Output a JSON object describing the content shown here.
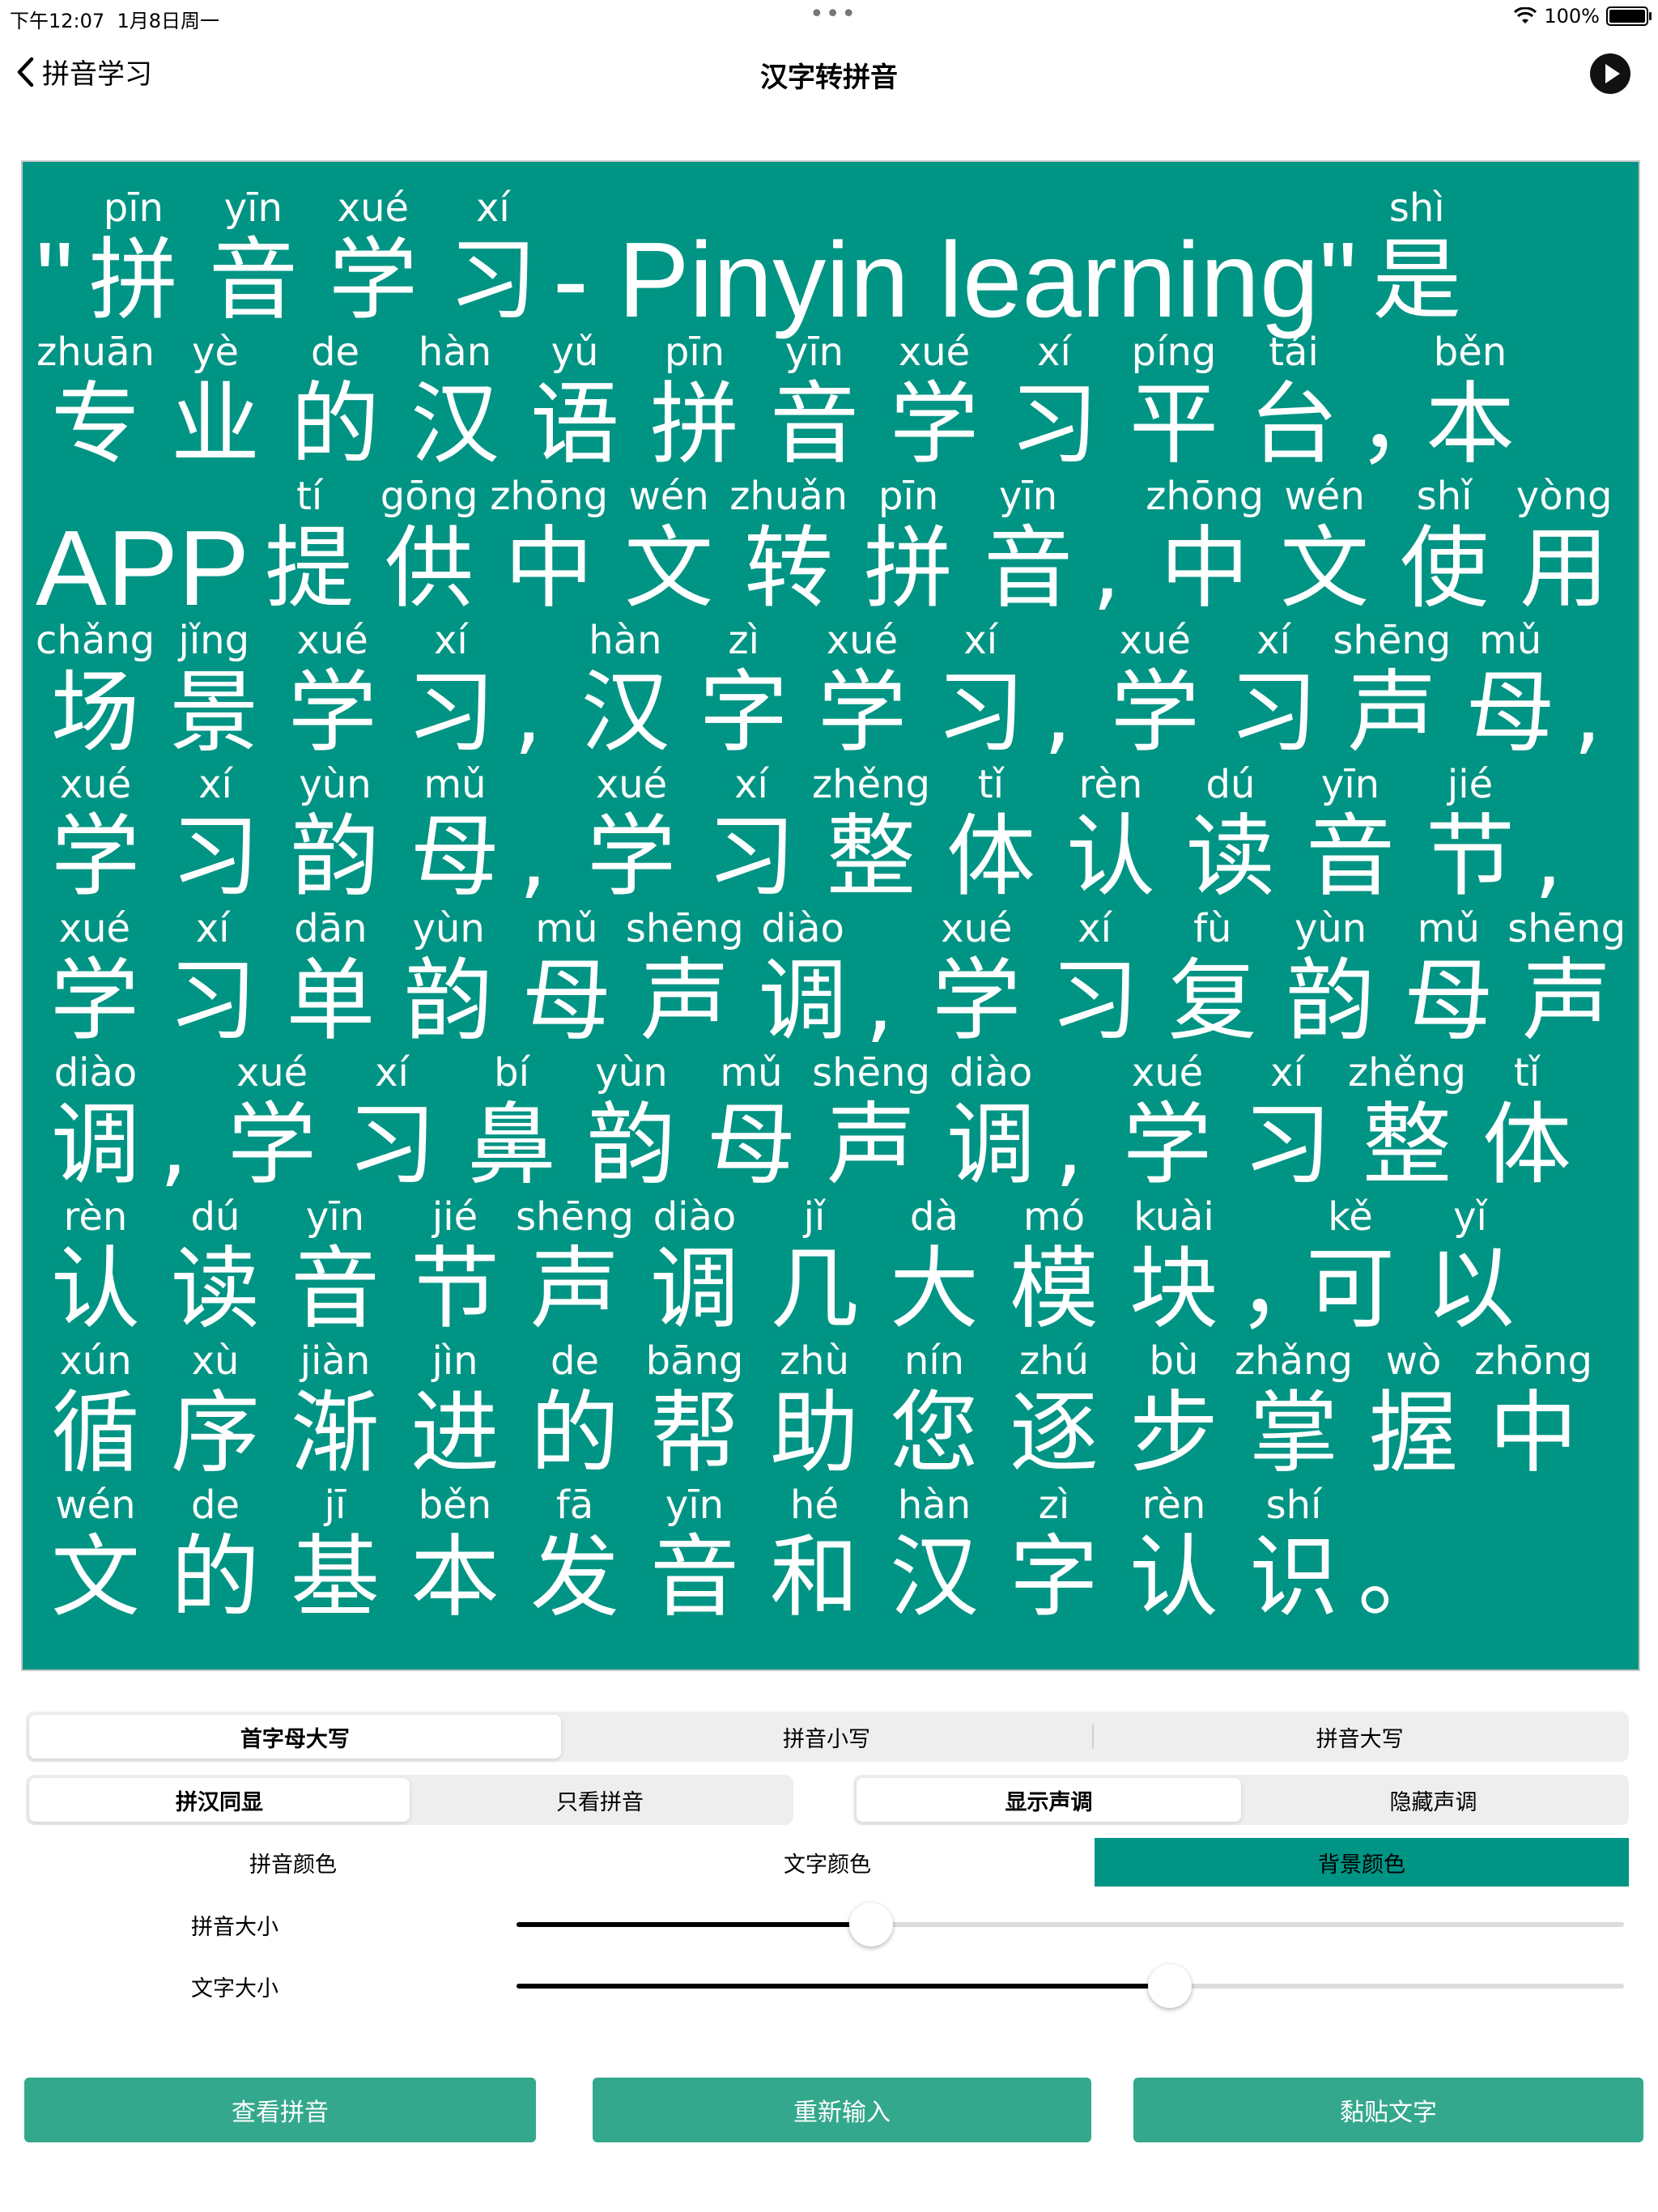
{
  "status": {
    "time": "下午12:07",
    "date": "1月8日周一",
    "dots": "•••",
    "battery_text": "100%",
    "battery_level": 1.0
  },
  "nav": {
    "back_label": "拼音学习",
    "title": "汉字转拼音"
  },
  "board": {
    "bg_color": "#009484",
    "lines": [
      [
        {
          "t": "seg",
          "hz": "\""
        },
        {
          "hz": "拼",
          "py": "pīn"
        },
        {
          "hz": "音",
          "py": "yīn"
        },
        {
          "hz": "学",
          "py": "xué"
        },
        {
          "hz": "习",
          "py": "xí"
        },
        {
          "t": "seg",
          "hz": "- Pinyin learning\""
        },
        {
          "hz": "是",
          "py": "shì"
        }
      ],
      [
        {
          "hz": "专",
          "py": "zhuān"
        },
        {
          "hz": "业",
          "py": "yè"
        },
        {
          "hz": "的",
          "py": "de"
        },
        {
          "hz": "汉",
          "py": "hàn"
        },
        {
          "hz": "语",
          "py": "yǔ"
        },
        {
          "hz": "拼",
          "py": "pīn"
        },
        {
          "hz": "音",
          "py": "yīn"
        },
        {
          "hz": "学",
          "py": "xué"
        },
        {
          "hz": "习",
          "py": "xí"
        },
        {
          "hz": "平",
          "py": "píng"
        },
        {
          "hz": "台",
          "py": "tái"
        },
        {
          "t": "p",
          "hz": "，"
        },
        {
          "hz": "本",
          "py": "běn"
        }
      ],
      [
        {
          "t": "seg",
          "hz": "APP"
        },
        {
          "hz": "提",
          "py": "tí"
        },
        {
          "hz": "供",
          "py": "gōng"
        },
        {
          "hz": "中",
          "py": "zhōng"
        },
        {
          "hz": "文",
          "py": "wén"
        },
        {
          "hz": "转",
          "py": "zhuǎn"
        },
        {
          "hz": "拼",
          "py": "pīn"
        },
        {
          "hz": "音",
          "py": "yīn"
        },
        {
          "t": "p",
          "hz": ","
        },
        {
          "hz": "中",
          "py": "zhōng"
        },
        {
          "hz": "文",
          "py": "wén"
        },
        {
          "hz": "使",
          "py": "shǐ"
        },
        {
          "hz": "用",
          "py": "yòng"
        }
      ],
      [
        {
          "hz": "场",
          "py": "chǎng"
        },
        {
          "hz": "景",
          "py": "jǐng"
        },
        {
          "hz": "学",
          "py": "xué"
        },
        {
          "hz": "习",
          "py": "xí"
        },
        {
          "t": "p",
          "hz": ","
        },
        {
          "hz": "汉",
          "py": "hàn"
        },
        {
          "hz": "字",
          "py": "zì"
        },
        {
          "hz": "学",
          "py": "xué"
        },
        {
          "hz": "习",
          "py": "xí"
        },
        {
          "t": "p",
          "hz": ","
        },
        {
          "hz": "学",
          "py": "xué"
        },
        {
          "hz": "习",
          "py": "xí"
        },
        {
          "hz": "声",
          "py": "shēng"
        },
        {
          "hz": "母",
          "py": "mǔ"
        },
        {
          "t": "p",
          "hz": ","
        }
      ],
      [
        {
          "hz": "学",
          "py": "xué"
        },
        {
          "hz": "习",
          "py": "xí"
        },
        {
          "hz": "韵",
          "py": "yùn"
        },
        {
          "hz": "母",
          "py": "mǔ"
        },
        {
          "t": "p",
          "hz": ","
        },
        {
          "hz": "学",
          "py": "xué"
        },
        {
          "hz": "习",
          "py": "xí"
        },
        {
          "hz": "整",
          "py": "zhěng"
        },
        {
          "hz": "体",
          "py": "tǐ"
        },
        {
          "hz": "认",
          "py": "rèn"
        },
        {
          "hz": "读",
          "py": "dú"
        },
        {
          "hz": "音",
          "py": "yīn"
        },
        {
          "hz": "节",
          "py": "jié"
        },
        {
          "t": "p",
          "hz": ","
        }
      ],
      [
        {
          "hz": "学",
          "py": "xué"
        },
        {
          "hz": "习",
          "py": "xí"
        },
        {
          "hz": "单",
          "py": "dān"
        },
        {
          "hz": "韵",
          "py": "yùn"
        },
        {
          "hz": "母",
          "py": "mǔ"
        },
        {
          "hz": "声",
          "py": "shēng"
        },
        {
          "hz": "调",
          "py": "diào"
        },
        {
          "t": "p",
          "hz": ","
        },
        {
          "hz": "学",
          "py": "xué"
        },
        {
          "hz": "习",
          "py": "xí"
        },
        {
          "hz": "复",
          "py": "fù"
        },
        {
          "hz": "韵",
          "py": "yùn"
        },
        {
          "hz": "母",
          "py": "mǔ"
        },
        {
          "hz": "声",
          "py": "shēng"
        }
      ],
      [
        {
          "hz": "调",
          "py": "diào"
        },
        {
          "t": "p",
          "hz": ","
        },
        {
          "hz": "学",
          "py": "xué"
        },
        {
          "hz": "习",
          "py": "xí"
        },
        {
          "hz": "鼻",
          "py": "bí"
        },
        {
          "hz": "韵",
          "py": "yùn"
        },
        {
          "hz": "母",
          "py": "mǔ"
        },
        {
          "hz": "声",
          "py": "shēng"
        },
        {
          "hz": "调",
          "py": "diào"
        },
        {
          "t": "p",
          "hz": ","
        },
        {
          "hz": "学",
          "py": "xué"
        },
        {
          "hz": "习",
          "py": "xí"
        },
        {
          "hz": "整",
          "py": "zhěng"
        },
        {
          "hz": "体",
          "py": "tǐ"
        }
      ],
      [
        {
          "hz": "认",
          "py": "rèn"
        },
        {
          "hz": "读",
          "py": "dú"
        },
        {
          "hz": "音",
          "py": "yīn"
        },
        {
          "hz": "节",
          "py": "jié"
        },
        {
          "hz": "声",
          "py": "shēng"
        },
        {
          "hz": "调",
          "py": "diào"
        },
        {
          "hz": "几",
          "py": "jǐ"
        },
        {
          "hz": "大",
          "py": "dà"
        },
        {
          "hz": "模",
          "py": "mó"
        },
        {
          "hz": "块",
          "py": "kuài"
        },
        {
          "t": "p",
          "hz": "，"
        },
        {
          "hz": "可",
          "py": "kě"
        },
        {
          "hz": "以",
          "py": "yǐ"
        }
      ],
      [
        {
          "hz": "循",
          "py": "xún"
        },
        {
          "hz": "序",
          "py": "xù"
        },
        {
          "hz": "渐",
          "py": "jiàn"
        },
        {
          "hz": "进",
          "py": "jìn"
        },
        {
          "hz": "的",
          "py": "de"
        },
        {
          "hz": "帮",
          "py": "bāng"
        },
        {
          "hz": "助",
          "py": "zhù"
        },
        {
          "hz": "您",
          "py": "nín"
        },
        {
          "hz": "逐",
          "py": "zhú"
        },
        {
          "hz": "步",
          "py": "bù"
        },
        {
          "hz": "掌",
          "py": "zhǎng"
        },
        {
          "hz": "握",
          "py": "wò"
        },
        {
          "hz": "中",
          "py": "zhōng"
        }
      ],
      [
        {
          "hz": "文",
          "py": "wén"
        },
        {
          "hz": "的",
          "py": "de"
        },
        {
          "hz": "基",
          "py": "jī"
        },
        {
          "hz": "本",
          "py": "běn"
        },
        {
          "hz": "发",
          "py": "fā"
        },
        {
          "hz": "音",
          "py": "yīn"
        },
        {
          "hz": "和",
          "py": "hé"
        },
        {
          "hz": "汉",
          "py": "hàn"
        },
        {
          "hz": "字",
          "py": "zì"
        },
        {
          "hz": "认",
          "py": "rèn"
        },
        {
          "hz": "识",
          "py": "shí"
        },
        {
          "t": "p",
          "hz": "。"
        }
      ]
    ]
  },
  "case_options": {
    "items": [
      "首字母大写",
      "拼音小写",
      "拼音大写"
    ],
    "selected": 0
  },
  "display_mode": {
    "items": [
      "拼汉同显",
      "只看拼音"
    ],
    "selected": 0
  },
  "tone_mode": {
    "items": [
      "显示声调",
      "隐藏声调"
    ],
    "selected": 0
  },
  "color_options": {
    "items": [
      "拼音颜色",
      "文字颜色",
      "背景颜色"
    ],
    "selected": 2
  },
  "sliders": {
    "pinyin_size": {
      "label": "拼音大小",
      "value": 0.32
    },
    "text_size": {
      "label": "文字大小",
      "value": 0.59
    }
  },
  "actions": {
    "view": "查看拼音",
    "reinput": "重新输入",
    "paste": "黏贴文字"
  }
}
